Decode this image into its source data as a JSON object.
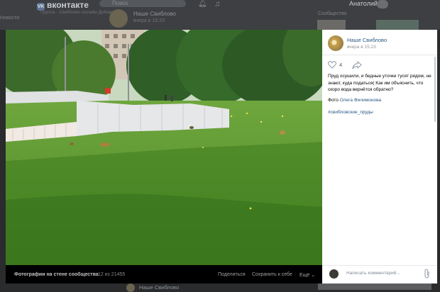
{
  "background": {
    "logo": "вконтакте",
    "search_placeholder": "Поиск",
    "user_name": "Анатолий",
    "left_side_text": "Новости",
    "under_logo": "Группа · Свиблово онлайн\nДобавить в ...",
    "post_author": "Наше Свиблово",
    "post_time": "вчера в 15:23",
    "right_side_text": "Сообщество",
    "bottom_author": "Наше Свиблово"
  },
  "viewer": {
    "footer": {
      "album_label": "Фотографии на стене сообщества",
      "counter": "12 из 21455",
      "share_label": "Поделиться",
      "save_label": "Сохранить к себе",
      "more_label": "Ещё ⌄"
    },
    "panel": {
      "community_name": "Наше Свиблово",
      "post_time": "вчера в 15:23",
      "likes": "4",
      "post_text": "Пруд осушили, и бедные уточки тусят рядом, не знают, куда податься( Как им объяснить, что скоро вода вернётся обратно?",
      "credit_prefix": "Фото ",
      "credit_name": "Олега Филимонова",
      "hashtag": "#свибловские_пруды",
      "comment_placeholder": "Написать комментарий..."
    }
  },
  "colors": {
    "link": "#2a5885",
    "grass": "#4f8a2c",
    "fence": "#e9eaec",
    "overlay": "#2a2b2d"
  }
}
